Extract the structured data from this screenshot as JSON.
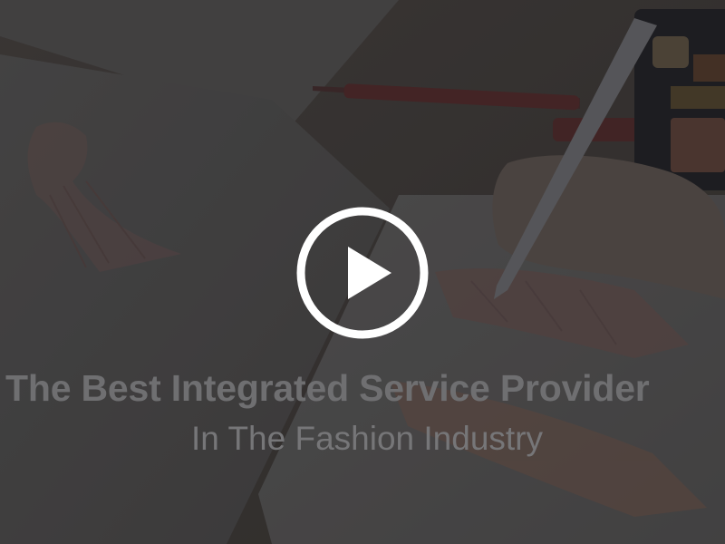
{
  "video": {
    "headline": "The Best Integrated Service Provider",
    "subheadline": "In The Fashion Industry"
  },
  "colors": {
    "overlay": "#1e1e22",
    "text": "#6f6f71",
    "play_ring": "#ffffff"
  },
  "icons": {
    "play": "play-icon"
  }
}
